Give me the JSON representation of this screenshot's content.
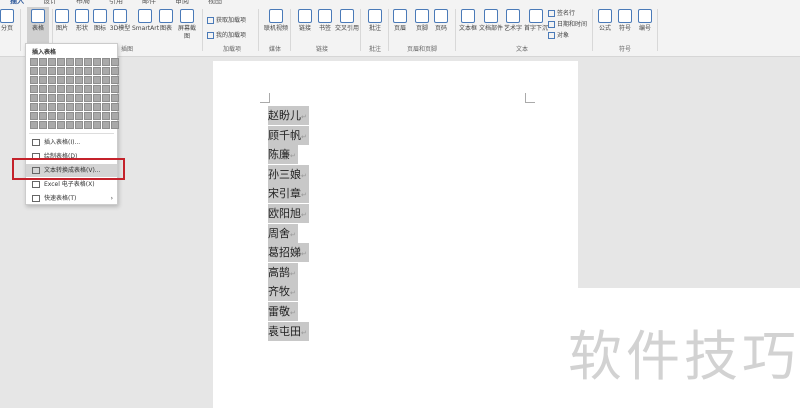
{
  "tabs": [
    "插入",
    "设计",
    "布局",
    "引用",
    "邮件",
    "审阅",
    "视图"
  ],
  "ribbon": {
    "page_break": "分页",
    "table": "表格",
    "illus": [
      "图片",
      "形状",
      "图标",
      "3D模型",
      "SmartArt",
      "图表",
      "屏幕截图"
    ],
    "illus_label": "插图",
    "addins": [
      "获取加载项",
      "我的加载项"
    ],
    "addins_label": "加载项",
    "media": "联机视频",
    "media_label": "媒体",
    "links": [
      "链接",
      "书签",
      "交叉引用"
    ],
    "links_label": "链接",
    "comment": "批注",
    "comment_label": "批注",
    "hf": [
      "页眉",
      "页脚",
      "页码"
    ],
    "hf_label": "页眉和页脚",
    "text": [
      "文本框",
      "文档部件",
      "艺术字",
      "首字下沉"
    ],
    "text_small": [
      "签名行",
      "日期和时间",
      "对象"
    ],
    "text_label": "文本",
    "symbols": [
      "公式",
      "符号",
      "编号"
    ],
    "symbols_label": "符号"
  },
  "dropdown": {
    "title": "插入表格",
    "grid_cols": 10,
    "grid_rows": 8,
    "items": [
      "插入表格(I)...",
      "绘制表格(D)",
      "文本转换成表格(V)...",
      "Excel 电子表格(X)",
      "快速表格(T)"
    ],
    "highlighted": "文本转换成表格(V)..."
  },
  "document": {
    "lines": [
      "赵盼儿",
      "顾千帆",
      "陈廉",
      "孙三娘",
      "宋引章",
      "欧阳旭",
      "周舍",
      "葛招娣",
      "高鹄",
      "齐牧",
      "雷敬",
      "袁屯田"
    ]
  },
  "watermark": "软件技巧",
  "colors": {
    "highlight_box": "#c4222b",
    "selection": "#c8c8c8"
  }
}
